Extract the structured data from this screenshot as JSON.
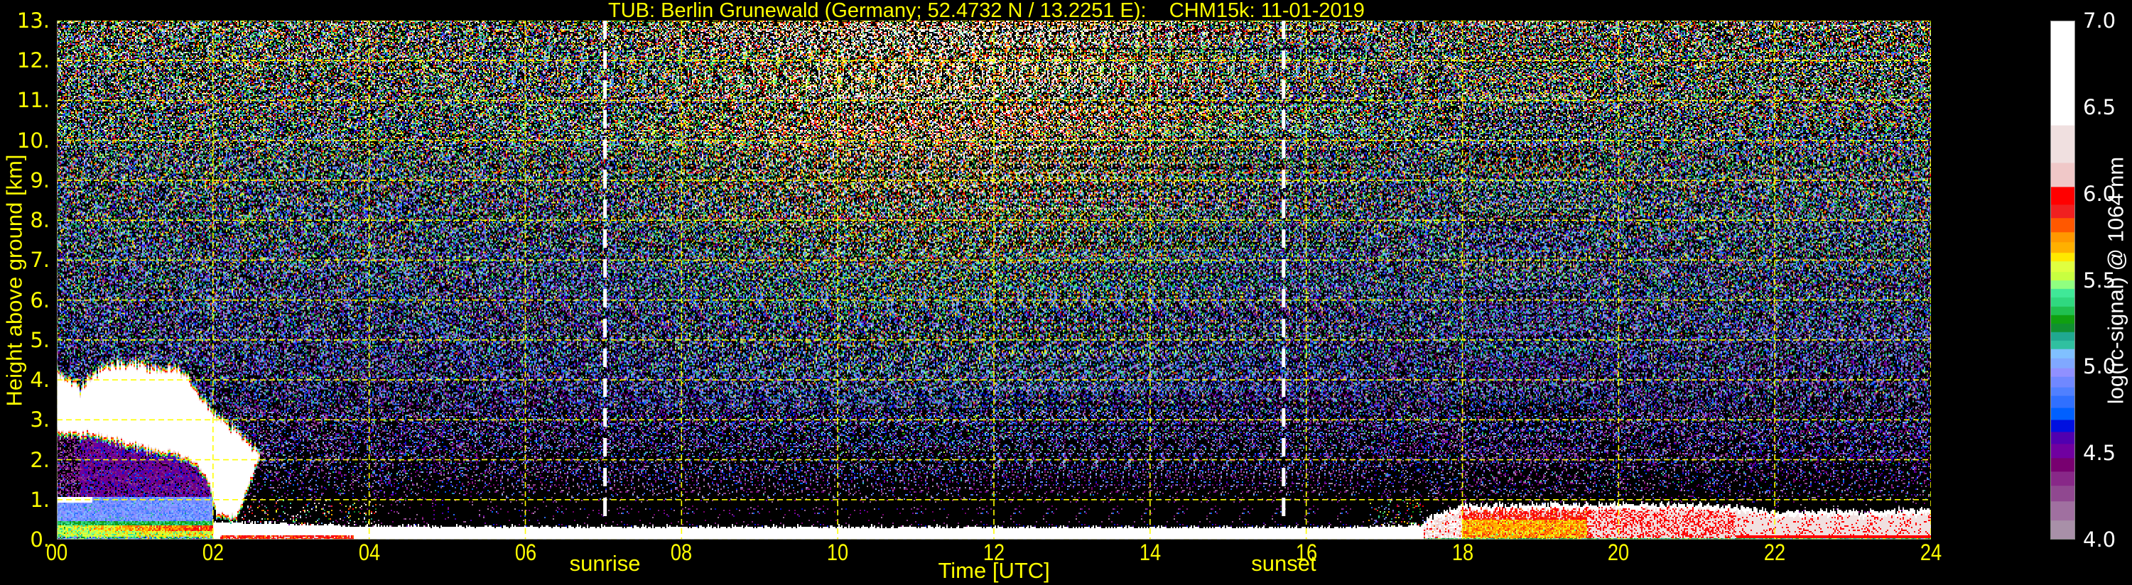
{
  "chart_data": {
    "type": "heatmap",
    "title": "TUB: Berlin Grunewald (Germany; 52.4732 N / 13.2251 E):    CHM15k: 11-01-2019",
    "xlabel": "Time [UTC]",
    "ylabel": "Height above ground [km]",
    "xlim": [
      0,
      24
    ],
    "ylim": [
      0,
      13
    ],
    "xticks": [
      "00",
      "02",
      "04",
      "06",
      "08",
      "10",
      "12",
      "14",
      "16",
      "18",
      "20",
      "22",
      "24"
    ],
    "xtick_values": [
      0,
      2,
      4,
      6,
      8,
      10,
      12,
      14,
      16,
      18,
      20,
      22,
      24
    ],
    "yticks": [
      "0.",
      "1.",
      "2.",
      "3.",
      "4.",
      "5.",
      "6.",
      "7.",
      "8.",
      "9.",
      "10.",
      "11.",
      "12.",
      "13."
    ],
    "ytick_values": [
      0,
      1,
      2,
      3,
      4,
      5,
      6,
      7,
      8,
      9,
      10,
      11,
      12,
      13
    ],
    "grid": true,
    "grid_color": "#ffff00",
    "vertical_markers": [
      {
        "label": "sunrise",
        "time": 7.02,
        "color": "#ffffff"
      },
      {
        "label": "sunset",
        "time": 15.71,
        "color": "#ffffff"
      }
    ],
    "colorbar": {
      "label": "log(rc-signal) @ 1064 nm",
      "range": [
        4.0,
        7.0
      ],
      "ticks": [
        "4.0",
        "4.5",
        "5.0",
        "5.5",
        "6.0",
        "6.5",
        "7.0"
      ],
      "tick_values": [
        4.0,
        4.5,
        5.0,
        5.5,
        6.0,
        6.5,
        7.0
      ],
      "below_range_color": "#000000",
      "levels": [
        {
          "from": 4.0,
          "color": "#a890a8"
        },
        {
          "from": 4.11,
          "color": "#a070a0"
        },
        {
          "from": 4.22,
          "color": "#904890"
        },
        {
          "from": 4.31,
          "color": "#882888"
        },
        {
          "from": 4.39,
          "color": "#780070"
        },
        {
          "from": 4.47,
          "color": "#7000a0"
        },
        {
          "from": 4.55,
          "color": "#5000b0"
        },
        {
          "from": 4.62,
          "color": "#0010e0"
        },
        {
          "from": 4.69,
          "color": "#0060ff"
        },
        {
          "from": 4.76,
          "color": "#3070ff"
        },
        {
          "from": 4.83,
          "color": "#5080ff"
        },
        {
          "from": 4.88,
          "color": "#7088ff"
        },
        {
          "from": 4.94,
          "color": "#9090ff"
        },
        {
          "from": 4.99,
          "color": "#80a8ff"
        },
        {
          "from": 5.05,
          "color": "#80c0ff"
        },
        {
          "from": 5.1,
          "color": "#30c0a0"
        },
        {
          "from": 5.15,
          "color": "#20a890"
        },
        {
          "from": 5.2,
          "color": "#109030"
        },
        {
          "from": 5.25,
          "color": "#10a010"
        },
        {
          "from": 5.3,
          "color": "#20c050"
        },
        {
          "from": 5.35,
          "color": "#30d880"
        },
        {
          "from": 5.4,
          "color": "#40e898"
        },
        {
          "from": 5.45,
          "color": "#90ff80"
        },
        {
          "from": 5.5,
          "color": "#c8ff40"
        },
        {
          "from": 5.55,
          "color": "#e0ff40"
        },
        {
          "from": 5.61,
          "color": "#ffe800"
        },
        {
          "from": 5.66,
          "color": "#ffb000"
        },
        {
          "from": 5.72,
          "color": "#ff9800"
        },
        {
          "from": 5.78,
          "color": "#ff5800"
        },
        {
          "from": 5.86,
          "color": "#f02020"
        },
        {
          "from": 5.94,
          "color": "#ff0000"
        },
        {
          "from": 6.04,
          "color": "#f0c8c8"
        },
        {
          "from": 6.18,
          "color": "#f0e0e0"
        },
        {
          "from": 6.4,
          "color": "#ffffff"
        }
      ]
    },
    "features": {
      "cloud_top": [
        [
          0.0,
          4.3
        ],
        [
          0.3,
          3.9
        ],
        [
          0.6,
          4.4
        ],
        [
          0.9,
          4.5
        ],
        [
          1.3,
          4.4
        ],
        [
          1.6,
          4.3
        ],
        [
          1.8,
          3.8
        ],
        [
          2.0,
          3.2
        ],
        [
          2.3,
          2.8
        ],
        [
          2.6,
          2.2
        ]
      ],
      "cloud_base": [
        [
          0.0,
          2.6
        ],
        [
          0.5,
          2.5
        ],
        [
          1.0,
          2.25
        ],
        [
          1.5,
          2.05
        ],
        [
          1.8,
          1.8
        ],
        [
          1.95,
          1.3
        ],
        [
          2.05,
          0.5
        ],
        [
          2.3,
          0.45
        ],
        [
          2.6,
          2.0
        ]
      ],
      "ground_layer_top": [
        [
          2.0,
          0.42
        ],
        [
          2.5,
          0.4
        ],
        [
          4.0,
          0.3
        ],
        [
          16.5,
          0.28
        ],
        [
          17.5,
          0.33
        ]
      ],
      "evening_layer_top": [
        [
          17.5,
          0.5
        ],
        [
          18.0,
          0.85
        ],
        [
          20.5,
          0.9
        ],
        [
          21.5,
          0.85
        ],
        [
          22.0,
          0.7
        ],
        [
          24.0,
          0.75
        ]
      ]
    }
  }
}
